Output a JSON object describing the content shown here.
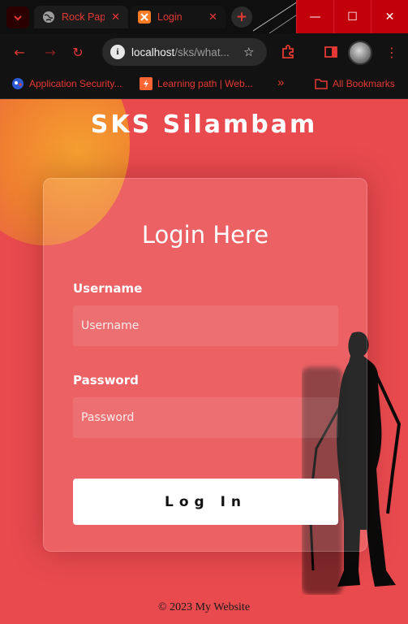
{
  "browser": {
    "tabs": [
      {
        "title": "Rock Pape",
        "icon": "globe-icon"
      },
      {
        "title": "Login",
        "icon": "xampp-icon"
      }
    ],
    "address": {
      "host": "localhost",
      "path": "/sks/what..."
    },
    "bookmarks": [
      {
        "label": "Application Security...",
        "icon": "app-security-icon"
      },
      {
        "label": "Learning path | Web...",
        "icon": "portswigger-icon"
      }
    ],
    "bookmarks_overflow": "»",
    "all_bookmarks": "All Bookmarks",
    "colors": {
      "accent": "#e53935",
      "window_controls": "#c1000c"
    }
  },
  "page": {
    "site_title": "SKS Silambam",
    "form": {
      "heading": "Login Here",
      "username_label": "Username",
      "username_placeholder": "Username",
      "password_label": "Password",
      "password_placeholder": "Password",
      "submit_label": "Log In"
    },
    "footer": "© 2023 My Website",
    "colors": {
      "background": "#e94a4e",
      "button_bg": "#ffffff"
    }
  }
}
